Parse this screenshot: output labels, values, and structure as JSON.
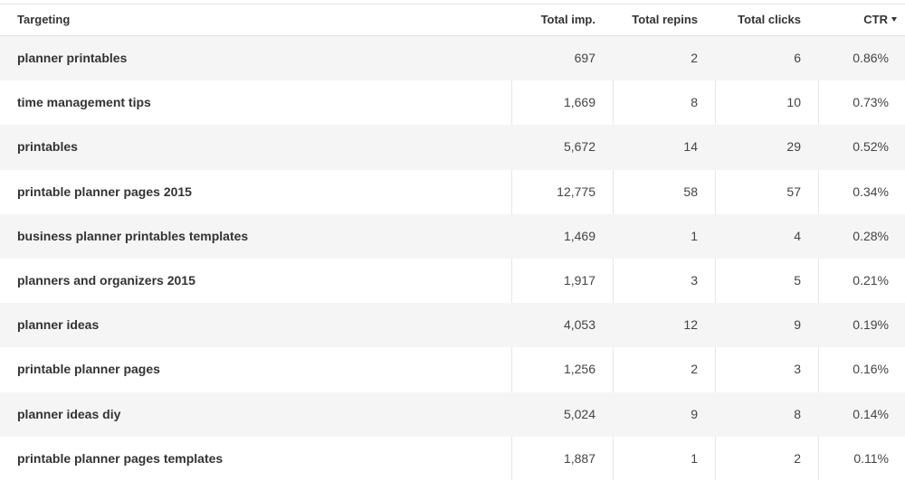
{
  "table": {
    "columns": {
      "targeting": "Targeting",
      "total_impressions": "Total imp.",
      "total_repins": "Total repins",
      "total_clicks": "Total clicks",
      "ctr": "CTR",
      "ctr_sort_icon": "sort-descending-caret"
    },
    "rows": [
      {
        "targeting": "planner printables",
        "total_impressions": "697",
        "total_repins": "2",
        "total_clicks": "6",
        "ctr": "0.86%"
      },
      {
        "targeting": "time management tips",
        "total_impressions": "1,669",
        "total_repins": "8",
        "total_clicks": "10",
        "ctr": "0.73%"
      },
      {
        "targeting": "printables",
        "total_impressions": "5,672",
        "total_repins": "14",
        "total_clicks": "29",
        "ctr": "0.52%"
      },
      {
        "targeting": "printable planner pages 2015",
        "total_impressions": "12,775",
        "total_repins": "58",
        "total_clicks": "57",
        "ctr": "0.34%"
      },
      {
        "targeting": "business planner printables templates",
        "total_impressions": "1,469",
        "total_repins": "1",
        "total_clicks": "4",
        "ctr": "0.28%"
      },
      {
        "targeting": "planners and organizers 2015",
        "total_impressions": "1,917",
        "total_repins": "3",
        "total_clicks": "5",
        "ctr": "0.21%"
      },
      {
        "targeting": "planner ideas",
        "total_impressions": "4,053",
        "total_repins": "12",
        "total_clicks": "9",
        "ctr": "0.19%"
      },
      {
        "targeting": "printable planner pages",
        "total_impressions": "1,256",
        "total_repins": "2",
        "total_clicks": "3",
        "ctr": "0.16%"
      },
      {
        "targeting": "planner ideas diy",
        "total_impressions": "5,024",
        "total_repins": "9",
        "total_clicks": "8",
        "ctr": "0.14%"
      },
      {
        "targeting": "printable planner pages templates",
        "total_impressions": "1,887",
        "total_repins": "1",
        "total_clicks": "2",
        "ctr": "0.11%"
      }
    ]
  },
  "colors": {
    "header_text": "#333333",
    "row_alt_background": "#f5f5f5",
    "divider": "#e6e6e6"
  }
}
